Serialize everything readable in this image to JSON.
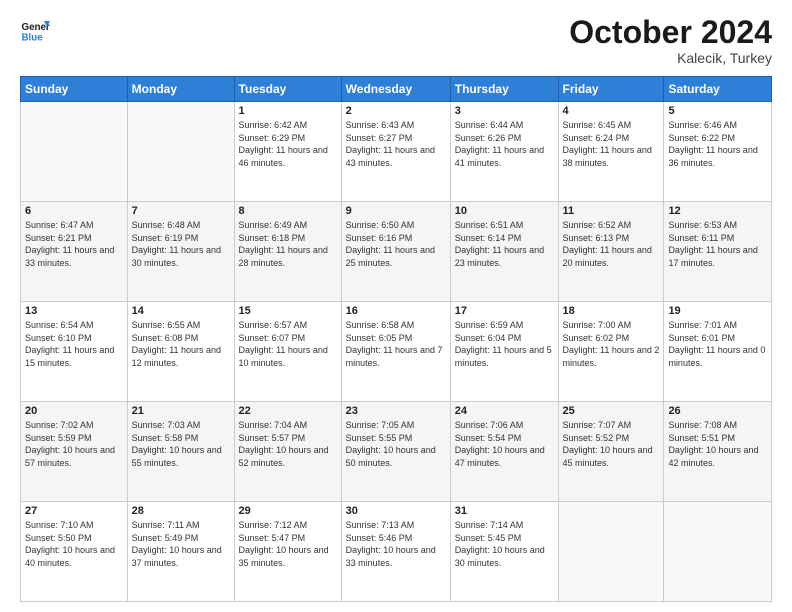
{
  "header": {
    "logo_general": "General",
    "logo_blue": "Blue",
    "month": "October 2024",
    "location": "Kalecik, Turkey"
  },
  "days_of_week": [
    "Sunday",
    "Monday",
    "Tuesday",
    "Wednesday",
    "Thursday",
    "Friday",
    "Saturday"
  ],
  "weeks": [
    [
      {
        "day": "",
        "sunrise": "",
        "sunset": "",
        "daylight": ""
      },
      {
        "day": "",
        "sunrise": "",
        "sunset": "",
        "daylight": ""
      },
      {
        "day": "1",
        "sunrise": "Sunrise: 6:42 AM",
        "sunset": "Sunset: 6:29 PM",
        "daylight": "Daylight: 11 hours and 46 minutes."
      },
      {
        "day": "2",
        "sunrise": "Sunrise: 6:43 AM",
        "sunset": "Sunset: 6:27 PM",
        "daylight": "Daylight: 11 hours and 43 minutes."
      },
      {
        "day": "3",
        "sunrise": "Sunrise: 6:44 AM",
        "sunset": "Sunset: 6:26 PM",
        "daylight": "Daylight: 11 hours and 41 minutes."
      },
      {
        "day": "4",
        "sunrise": "Sunrise: 6:45 AM",
        "sunset": "Sunset: 6:24 PM",
        "daylight": "Daylight: 11 hours and 38 minutes."
      },
      {
        "day": "5",
        "sunrise": "Sunrise: 6:46 AM",
        "sunset": "Sunset: 6:22 PM",
        "daylight": "Daylight: 11 hours and 36 minutes."
      }
    ],
    [
      {
        "day": "6",
        "sunrise": "Sunrise: 6:47 AM",
        "sunset": "Sunset: 6:21 PM",
        "daylight": "Daylight: 11 hours and 33 minutes."
      },
      {
        "day": "7",
        "sunrise": "Sunrise: 6:48 AM",
        "sunset": "Sunset: 6:19 PM",
        "daylight": "Daylight: 11 hours and 30 minutes."
      },
      {
        "day": "8",
        "sunrise": "Sunrise: 6:49 AM",
        "sunset": "Sunset: 6:18 PM",
        "daylight": "Daylight: 11 hours and 28 minutes."
      },
      {
        "day": "9",
        "sunrise": "Sunrise: 6:50 AM",
        "sunset": "Sunset: 6:16 PM",
        "daylight": "Daylight: 11 hours and 25 minutes."
      },
      {
        "day": "10",
        "sunrise": "Sunrise: 6:51 AM",
        "sunset": "Sunset: 6:14 PM",
        "daylight": "Daylight: 11 hours and 23 minutes."
      },
      {
        "day": "11",
        "sunrise": "Sunrise: 6:52 AM",
        "sunset": "Sunset: 6:13 PM",
        "daylight": "Daylight: 11 hours and 20 minutes."
      },
      {
        "day": "12",
        "sunrise": "Sunrise: 6:53 AM",
        "sunset": "Sunset: 6:11 PM",
        "daylight": "Daylight: 11 hours and 17 minutes."
      }
    ],
    [
      {
        "day": "13",
        "sunrise": "Sunrise: 6:54 AM",
        "sunset": "Sunset: 6:10 PM",
        "daylight": "Daylight: 11 hours and 15 minutes."
      },
      {
        "day": "14",
        "sunrise": "Sunrise: 6:55 AM",
        "sunset": "Sunset: 6:08 PM",
        "daylight": "Daylight: 11 hours and 12 minutes."
      },
      {
        "day": "15",
        "sunrise": "Sunrise: 6:57 AM",
        "sunset": "Sunset: 6:07 PM",
        "daylight": "Daylight: 11 hours and 10 minutes."
      },
      {
        "day": "16",
        "sunrise": "Sunrise: 6:58 AM",
        "sunset": "Sunset: 6:05 PM",
        "daylight": "Daylight: 11 hours and 7 minutes."
      },
      {
        "day": "17",
        "sunrise": "Sunrise: 6:59 AM",
        "sunset": "Sunset: 6:04 PM",
        "daylight": "Daylight: 11 hours and 5 minutes."
      },
      {
        "day": "18",
        "sunrise": "Sunrise: 7:00 AM",
        "sunset": "Sunset: 6:02 PM",
        "daylight": "Daylight: 11 hours and 2 minutes."
      },
      {
        "day": "19",
        "sunrise": "Sunrise: 7:01 AM",
        "sunset": "Sunset: 6:01 PM",
        "daylight": "Daylight: 11 hours and 0 minutes."
      }
    ],
    [
      {
        "day": "20",
        "sunrise": "Sunrise: 7:02 AM",
        "sunset": "Sunset: 5:59 PM",
        "daylight": "Daylight: 10 hours and 57 minutes."
      },
      {
        "day": "21",
        "sunrise": "Sunrise: 7:03 AM",
        "sunset": "Sunset: 5:58 PM",
        "daylight": "Daylight: 10 hours and 55 minutes."
      },
      {
        "day": "22",
        "sunrise": "Sunrise: 7:04 AM",
        "sunset": "Sunset: 5:57 PM",
        "daylight": "Daylight: 10 hours and 52 minutes."
      },
      {
        "day": "23",
        "sunrise": "Sunrise: 7:05 AM",
        "sunset": "Sunset: 5:55 PM",
        "daylight": "Daylight: 10 hours and 50 minutes."
      },
      {
        "day": "24",
        "sunrise": "Sunrise: 7:06 AM",
        "sunset": "Sunset: 5:54 PM",
        "daylight": "Daylight: 10 hours and 47 minutes."
      },
      {
        "day": "25",
        "sunrise": "Sunrise: 7:07 AM",
        "sunset": "Sunset: 5:52 PM",
        "daylight": "Daylight: 10 hours and 45 minutes."
      },
      {
        "day": "26",
        "sunrise": "Sunrise: 7:08 AM",
        "sunset": "Sunset: 5:51 PM",
        "daylight": "Daylight: 10 hours and 42 minutes."
      }
    ],
    [
      {
        "day": "27",
        "sunrise": "Sunrise: 7:10 AM",
        "sunset": "Sunset: 5:50 PM",
        "daylight": "Daylight: 10 hours and 40 minutes."
      },
      {
        "day": "28",
        "sunrise": "Sunrise: 7:11 AM",
        "sunset": "Sunset: 5:49 PM",
        "daylight": "Daylight: 10 hours and 37 minutes."
      },
      {
        "day": "29",
        "sunrise": "Sunrise: 7:12 AM",
        "sunset": "Sunset: 5:47 PM",
        "daylight": "Daylight: 10 hours and 35 minutes."
      },
      {
        "day": "30",
        "sunrise": "Sunrise: 7:13 AM",
        "sunset": "Sunset: 5:46 PM",
        "daylight": "Daylight: 10 hours and 33 minutes."
      },
      {
        "day": "31",
        "sunrise": "Sunrise: 7:14 AM",
        "sunset": "Sunset: 5:45 PM",
        "daylight": "Daylight: 10 hours and 30 minutes."
      },
      {
        "day": "",
        "sunrise": "",
        "sunset": "",
        "daylight": ""
      },
      {
        "day": "",
        "sunrise": "",
        "sunset": "",
        "daylight": ""
      }
    ]
  ]
}
